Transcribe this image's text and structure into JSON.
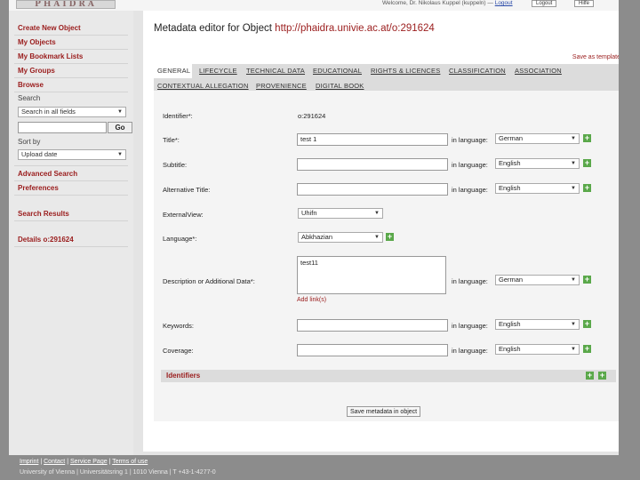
{
  "header": {
    "logo_text": "PHAIDRA",
    "user_text": "Welcome, Dr. Nikolaus Kuppel (kuppeln) —",
    "logout": "Logout",
    "lang_chip": "Logout",
    "help_chip": "Hilfe"
  },
  "sidebar": {
    "create": "Create New Object",
    "my_objects": "My Objects",
    "bookmarks": "My Bookmark Lists",
    "groups": "My Groups",
    "browse": "Browse",
    "search_label": "Search",
    "search_scope": "Search in all fields",
    "go": "Go",
    "sort_label": "Sort by",
    "sort_value": "Upload date",
    "advanced": "Advanced Search",
    "preferences": "Preferences",
    "results": "Search Results",
    "details": "Details o:291624"
  },
  "main": {
    "title_prefix": "Metadata editor for Object",
    "title_link": "http://phaidra.univie.ac.at/o:291624",
    "save_template": "Save as template",
    "tabs": [
      "GENERAL",
      "LIFECYCLE",
      "TECHNICAL DATA",
      "EDUCATIONAL",
      "RIGHTS & LICENCES",
      "CLASSIFICATION",
      "ASSOCIATION",
      "CONTEXTUAL ALLEGATION",
      "PROVENIENCE",
      "DIGITAL BOOK"
    ],
    "form": {
      "identifier_label": "Identifier*:",
      "identifier_value": "o:291624",
      "title_label": "Title*:",
      "title_value": "test 1",
      "subtitle_label": "Subtitle:",
      "alt_title_label": "Alternative Title:",
      "lang_label": "in language:",
      "title_lang": "German",
      "subtitle_lang": "English",
      "alt_title_lang": "English",
      "externalview_label": "ExternalView:",
      "externalview_value": "Uhifn",
      "language_label": "Language*:",
      "language_value": "Abkhazian",
      "desc_label": "Description or Additional Data*:",
      "desc_value": "test11",
      "desc_lang": "German",
      "add_links": "Add link(s)",
      "keywords_label": "Keywords:",
      "keywords_lang": "English",
      "coverage_label": "Coverage:",
      "coverage_lang": "English",
      "identifiers": "Identifiers",
      "save_button": "Save metadata in object"
    }
  },
  "footer": {
    "imprint": "Imprint",
    "contact": "Contact",
    "service": "Service Page",
    "terms": "Terms of use",
    "sep": " | ",
    "address": "University of Vienna | Universitätsring 1 | 1010 Vienna | T +43-1-4277-0"
  },
  "colors": {
    "accent_red": "#9a1c1c",
    "plus_green": "#5aa84a",
    "frame_gray": "#8c8c8c"
  },
  "icons": [
    "plus-icon",
    "caret-down-icon"
  ]
}
